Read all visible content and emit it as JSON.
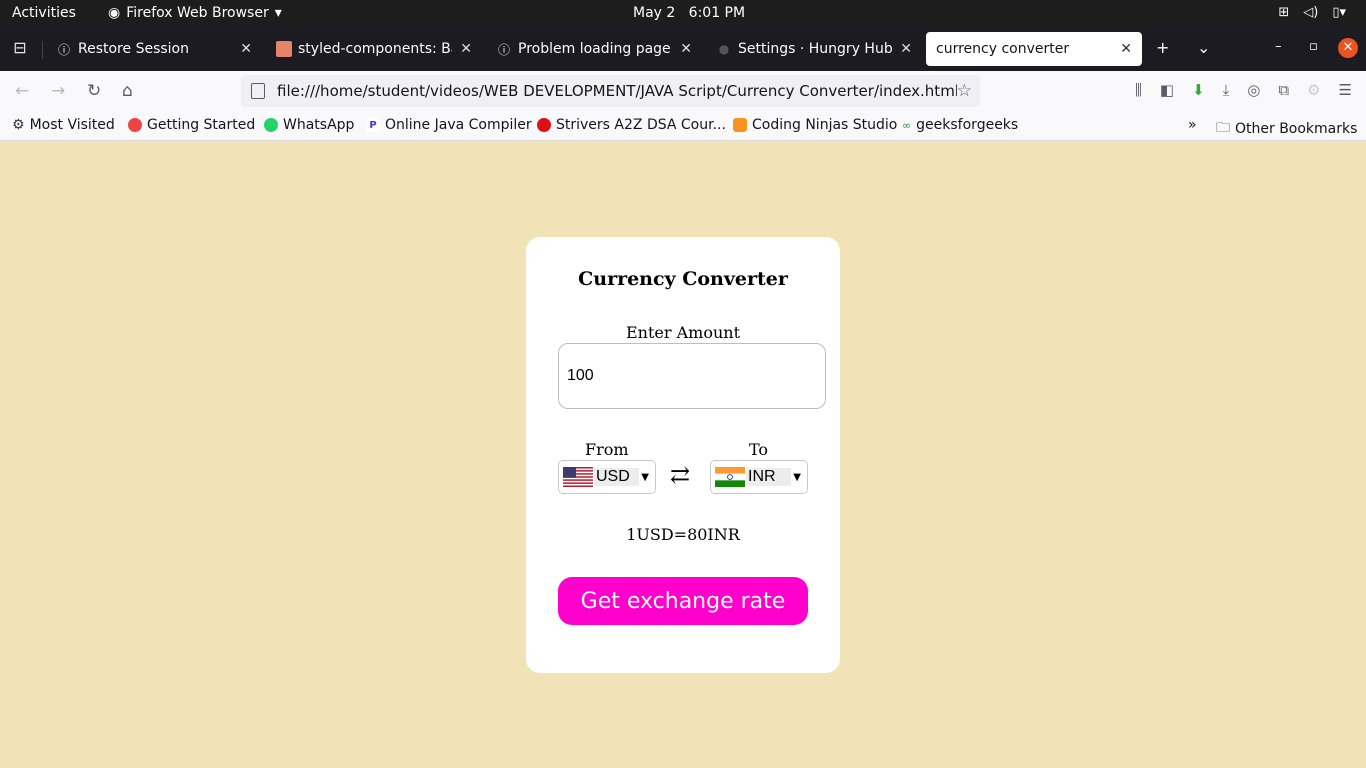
{
  "system": {
    "activities": "Activities",
    "app_name": "Firefox Web Browser",
    "date": "May 2",
    "time": "6:01 PM"
  },
  "browser": {
    "tabs": [
      {
        "title": "Restore Session"
      },
      {
        "title": "styled-components: Basic"
      },
      {
        "title": "Problem loading page"
      },
      {
        "title": "Settings · Hungry Hub"
      },
      {
        "title": "currency converter"
      }
    ],
    "url": "file:///home/student/videos/WEB DEVELOPMENT/JAVA Script/Currency Converter/index.html",
    "bookmarks": [
      {
        "label": "Most Visited"
      },
      {
        "label": "Getting Started"
      },
      {
        "label": "WhatsApp"
      },
      {
        "label": "Online Java Compiler"
      },
      {
        "label": "Strivers A2Z DSA Cour..."
      },
      {
        "label": "Coding Ninjas Studio"
      },
      {
        "label": "geeksforgeeks"
      }
    ],
    "other_bookmarks": "Other Bookmarks"
  },
  "converter": {
    "title": "Currency Converter",
    "amount_label": "Enter Amount",
    "amount_value": "100",
    "from_label": "From",
    "to_label": "To",
    "from_currency": "USD",
    "to_currency": "INR",
    "rate_text": "1USD=80INR",
    "button_label": "Get exchange rate"
  },
  "colors": {
    "page_background": "#f2e2b7",
    "button": "#ff00cc"
  }
}
